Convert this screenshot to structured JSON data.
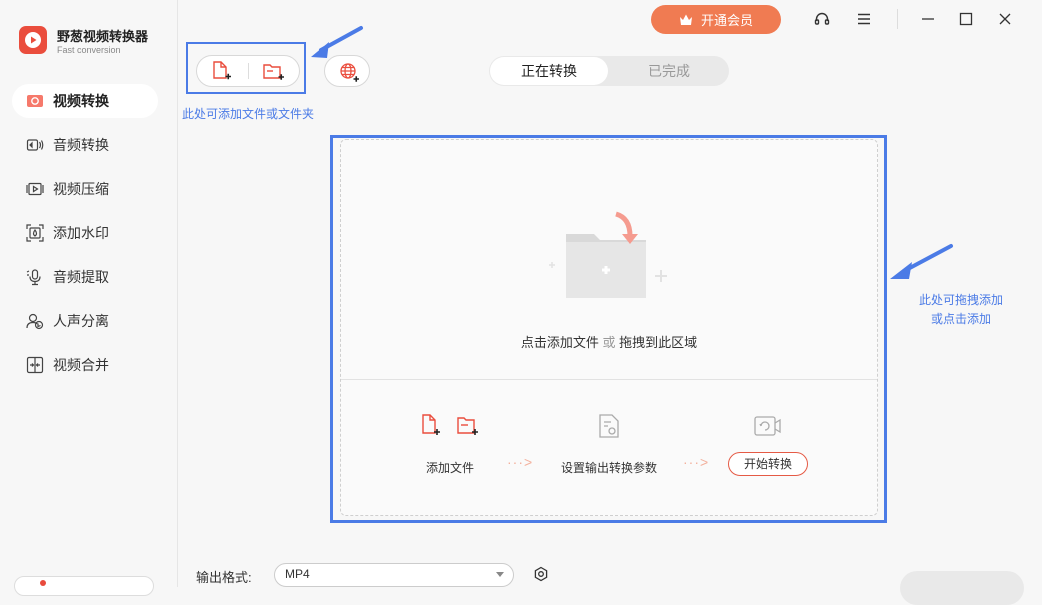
{
  "app": {
    "name": "野葱视频转换器",
    "subtitle": "Fast conversion"
  },
  "sidebar": {
    "items": [
      {
        "label": "视频转换",
        "icon": "video-convert-icon",
        "active": true
      },
      {
        "label": "音频转换",
        "icon": "audio-convert-icon"
      },
      {
        "label": "视频压缩",
        "icon": "video-compress-icon"
      },
      {
        "label": "添加水印",
        "icon": "watermark-icon"
      },
      {
        "label": "音频提取",
        "icon": "audio-extract-icon"
      },
      {
        "label": "人声分离",
        "icon": "vocal-separate-icon"
      },
      {
        "label": "视频合并",
        "icon": "video-merge-icon"
      }
    ]
  },
  "toolbar": {
    "hint": "此处可添加文件或文件夹"
  },
  "tabs": {
    "converting": "正在转换",
    "done": "已完成"
  },
  "titlebar": {
    "vip": "开通会员"
  },
  "drop": {
    "text_a": "点击添加文件",
    "text_or": "或",
    "text_b": "拖拽到此区域",
    "hint_right": [
      "此处可拖拽添加",
      "或点击添加"
    ]
  },
  "steps": {
    "add_file": "添加文件",
    "set_params": "设置输出转换参数",
    "start": "开始转换"
  },
  "arrows": "···>",
  "output": {
    "label": "输出格式:",
    "value": "MP4"
  },
  "colors": {
    "accent": "#ea4d3d",
    "annotation_blue": "#4b7be6",
    "vip": "#f07b52"
  }
}
